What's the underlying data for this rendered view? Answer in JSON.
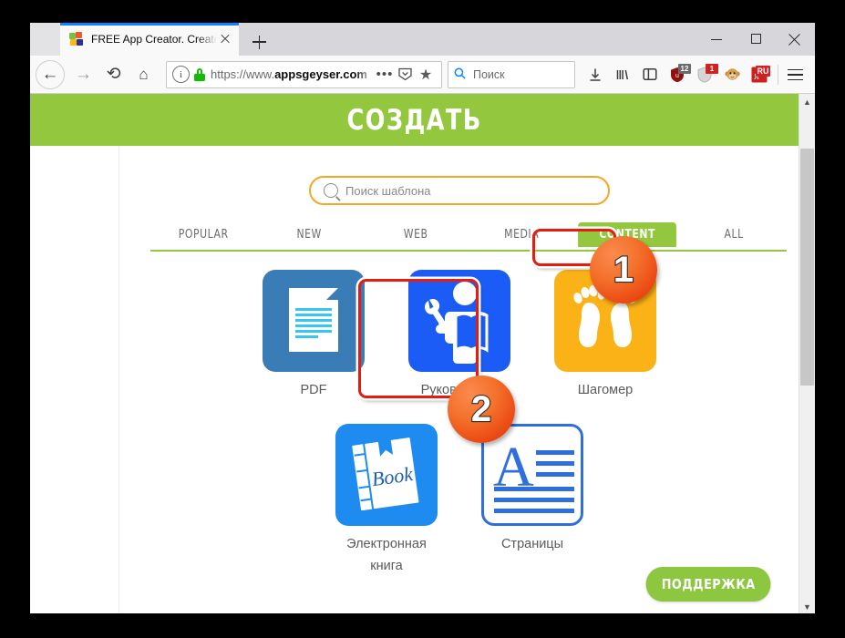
{
  "browser": {
    "tab": {
      "title": "FREE App Creator. Create Apps",
      "favicon": "appsgeyser-favicon",
      "close_label": "×"
    },
    "newtab_label": "+",
    "window_controls": {
      "minimize": "minimize",
      "maximize": "maximize",
      "close": "close"
    },
    "nav": {
      "back": "back-arrow",
      "forward": "forward-arrow",
      "reload": "reload",
      "home": "home"
    },
    "url": {
      "prefix": "https://www.",
      "domain": "appsgeyser.com",
      "info_icon": "i",
      "lock_icon": "secure-lock",
      "page_actions": "•••",
      "reader_icon": "reader-view",
      "bookmark_icon": "★"
    },
    "search": {
      "placeholder": "Поиск",
      "icon": "search-icon"
    },
    "toolbar_icons": [
      {
        "name": "downloads-icon",
        "glyph": "↓"
      },
      {
        "name": "library-icon",
        "glyph": "III\\"
      },
      {
        "name": "sidebar-icon",
        "glyph": "▯"
      },
      {
        "name": "ublock-origin-icon",
        "badge": "12",
        "badge_color": "#6b6b6b",
        "color": "#9b1313"
      },
      {
        "name": "adguard-shield-icon",
        "badge": "1",
        "badge_color": "#d32020",
        "color": "#c8c8c8"
      },
      {
        "name": "monkey-extension-icon",
        "glyph": "🐵"
      },
      {
        "name": "russian-translate-icon",
        "badge": "RU",
        "badge_color": "#d32020",
        "color": "#cf2020"
      },
      {
        "name": "hamburger-menu-icon",
        "glyph": "≡"
      }
    ]
  },
  "page": {
    "header_title": "СОЗДАТЬ",
    "brand_green": "#93c83e",
    "template_search": {
      "placeholder": "Поиск шаблона",
      "icon": "search-icon",
      "border_color": "#f5a623"
    },
    "tabs": [
      {
        "label": "POPULAR",
        "active": false
      },
      {
        "label": "NEW",
        "active": false
      },
      {
        "label": "WEB",
        "active": false
      },
      {
        "label": "MEDIA",
        "active": false
      },
      {
        "label": "CONTENT",
        "active": true
      },
      {
        "label": "ALL",
        "active": false
      }
    ],
    "templates_row1": [
      {
        "label": "PDF",
        "icon": "pdf-document-icon",
        "color": "#3a7cb5"
      },
      {
        "label": "Руководство",
        "icon": "manual-person-wrench-icon",
        "color": "#1a5cf5"
      },
      {
        "label": "Шагомер",
        "icon": "pedometer-footprints-icon",
        "color": "#fbb216"
      }
    ],
    "templates_row2": [
      {
        "label": "Электронная\nкнига",
        "line1": "Электронная",
        "line2": "книга",
        "icon": "ebook-book-icon",
        "color": "#1e8bf0",
        "book_text": "Book"
      },
      {
        "label": "Страницы",
        "icon": "pages-text-icon",
        "color": "#2f6fdd",
        "letter": "A"
      }
    ],
    "support_button": "ПОДДЕРЖКА",
    "annotations": [
      {
        "number": "1",
        "target": "content-tab"
      },
      {
        "number": "2",
        "target": "manual-template"
      }
    ]
  }
}
